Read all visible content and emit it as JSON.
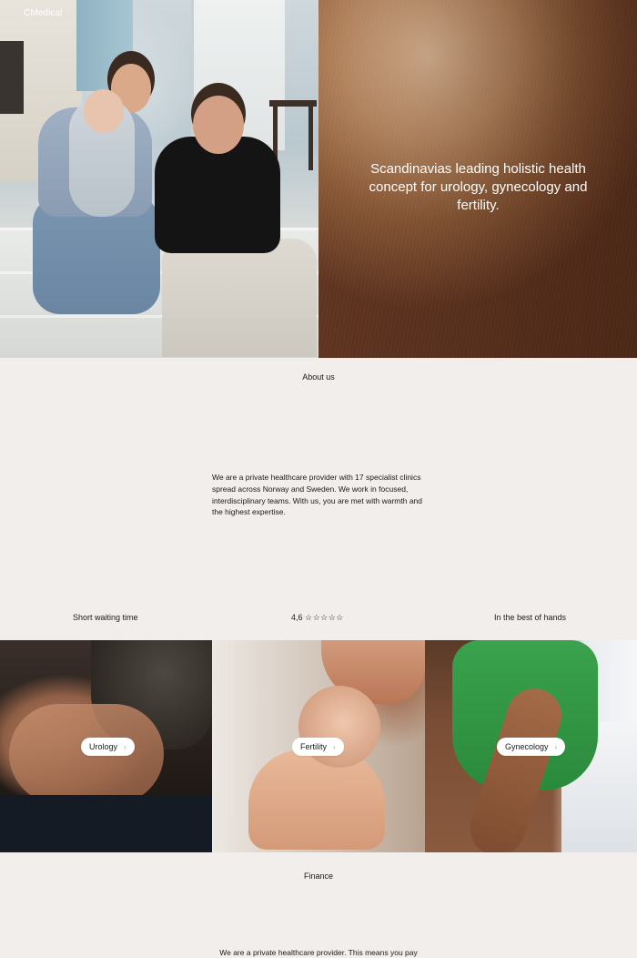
{
  "brand": {
    "logo": "CMedical"
  },
  "hero": {
    "tagline": "Scandinavias leading holistic health concept for urology, gynecology and fertility."
  },
  "about": {
    "label": "About us",
    "text": "We are a private healthcare provider with 17 specialist clinics spread across Norway and Sweden. We work in focused, interdisciplinary teams. With us, you are met with warmth and the highest expertise."
  },
  "usps": {
    "waiting": "Short waiting time",
    "rating_value": "4,6",
    "rating_stars": "☆☆☆☆☆",
    "hands": "In the best of hands"
  },
  "categories": [
    {
      "label": "Urology",
      "icon": "chevron-right-icon"
    },
    {
      "label": "Fertility",
      "icon": "chevron-right-icon"
    },
    {
      "label": "Gynecology",
      "icon": "chevron-right-icon"
    }
  ],
  "finance": {
    "label": "Finance",
    "text": "We are a private healthcare provider. This means you pay"
  },
  "colors": {
    "page_background": "#f2eeeb",
    "pill_background": "#ffffff",
    "text": "#1a1a1a"
  }
}
